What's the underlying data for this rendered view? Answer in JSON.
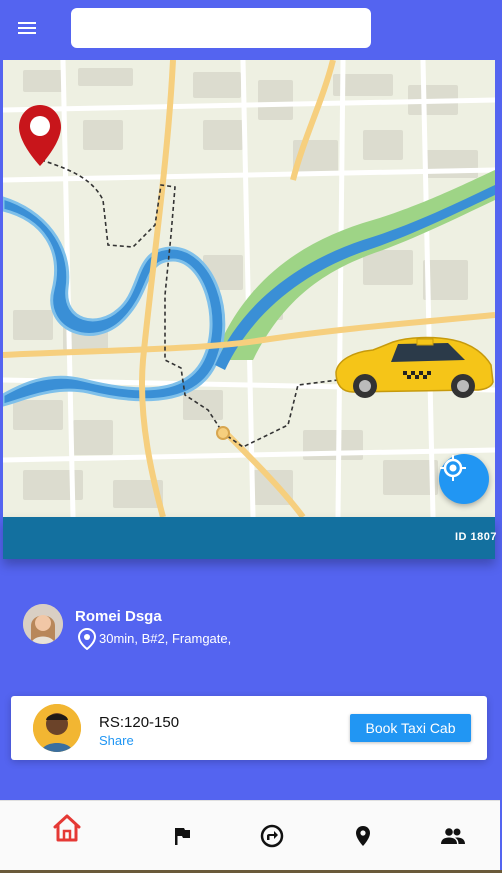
{
  "header": {
    "menu_icon": "menu-icon",
    "search": {
      "value": "",
      "placeholder": ""
    }
  },
  "map": {
    "trip_id": "ID 1807",
    "locate_icon": "crosshair-icon",
    "marker_icon": "map-pin-icon",
    "vehicle": "taxi-car"
  },
  "driver": {
    "name": "Romei Dsga",
    "address": "30min, B#2, Framgate,"
  },
  "fare": {
    "price": "RS:120-150",
    "share_label": "Share",
    "book_label": "Book Taxi Cab"
  },
  "nav": [
    {
      "icon": "home-icon",
      "active": true
    },
    {
      "icon": "flag-icon",
      "active": false
    },
    {
      "icon": "directions-icon",
      "active": false
    },
    {
      "icon": "location-pin-icon",
      "active": false
    },
    {
      "icon": "people-icon",
      "active": false
    }
  ],
  "colors": {
    "background": "#5464f0",
    "primary": "#2196f3",
    "active_nav": "#e53935",
    "map_strip": "#13709f"
  }
}
